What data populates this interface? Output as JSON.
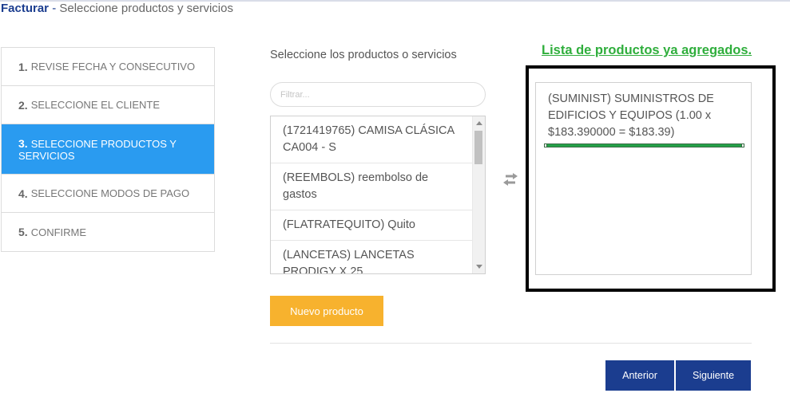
{
  "header": {
    "brand": "Facturar",
    "separator": " - ",
    "subtitle": "Seleccione productos y servicios"
  },
  "steps": [
    {
      "num": "1.",
      "label": "REVISE FECHA Y CONSECUTIVO",
      "active": false
    },
    {
      "num": "2.",
      "label": "SELECCIONE EL CLIENTE",
      "active": false
    },
    {
      "num": "3.",
      "label": "SELECCIONE PRODUCTOS Y SERVICIOS",
      "active": true
    },
    {
      "num": "4.",
      "label": "SELECCIONE MODOS DE PAGO",
      "active": false
    },
    {
      "num": "5.",
      "label": "CONFIRME",
      "active": false
    }
  ],
  "selector": {
    "title": "Seleccione los productos o servicios",
    "filter_placeholder": "Filtrar...",
    "items": [
      "(1721419765) CAMISA CLÁSICA CA004 - S",
      "(REEMBOLS) reembolso de gastos",
      "(FLATRATEQUITO) Quito",
      "(LANCETAS) LANCETAS PRODIGY X 25"
    ]
  },
  "added": {
    "title": "Lista de productos ya agregados.",
    "items": [
      "(SUMINIST) SUMINISTROS DE EDIFICIOS Y EQUIPOS (1.00 x $183.390000 = $183.39)"
    ]
  },
  "buttons": {
    "new_product": "Nuevo producto",
    "previous": "Anterior",
    "next": "Siguiente"
  },
  "colors": {
    "primary": "#1b3d8f",
    "active_step": "#2a9bf0",
    "warning": "#f7b22e",
    "added_title": "#2fae3c"
  }
}
